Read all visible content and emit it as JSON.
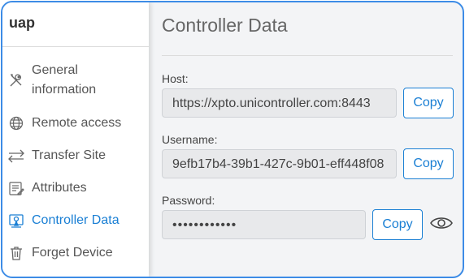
{
  "sidebar": {
    "device_name": "uap",
    "items": [
      {
        "label_line1": "General",
        "label_line2": "information",
        "icon": "tools-icon"
      },
      {
        "label": "Remote access",
        "icon": "globe-icon"
      },
      {
        "label": "Transfer Site",
        "icon": "transfer-arrows-icon"
      },
      {
        "label": "Attributes",
        "icon": "list-edit-icon"
      },
      {
        "label": "Controller Data",
        "icon": "controller-icon",
        "active": true
      },
      {
        "label": "Forget Device",
        "icon": "trash-icon"
      }
    ]
  },
  "main": {
    "title": "Controller Data",
    "host": {
      "label": "Host:",
      "value": "https://xpto.unicontroller.com:8443",
      "copy": "Copy"
    },
    "username": {
      "label": "Username:",
      "value": "9efb17b4-39b1-427c-9b01-eff448f08",
      "copy": "Copy"
    },
    "password": {
      "label": "Password:",
      "value": "••••••••••••",
      "copy": "Copy"
    }
  },
  "colors": {
    "accent": "#1a7fd4",
    "border": "#3d8ce6"
  }
}
